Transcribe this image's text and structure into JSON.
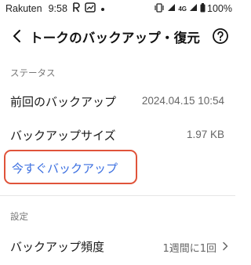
{
  "statusbar": {
    "carrier": "Rakuten",
    "time": "9:58",
    "network": "4G",
    "battery": "100%"
  },
  "appbar": {
    "title": "トークのバックアップ・復元"
  },
  "status_section": {
    "header": "ステータス",
    "last_backup_label": "前回のバックアップ",
    "last_backup_value": "2024.04.15 10:54",
    "backup_size_label": "バックアップサイズ",
    "backup_size_value": "1.97 KB",
    "backup_now_label": "今すぐバックアップ"
  },
  "settings_section": {
    "header": "設定",
    "frequency_label": "バックアップ頻度",
    "frequency_value": "1週間に1回"
  },
  "colors": {
    "link": "#3b6fe0",
    "highlight_outline": "#e0533a"
  }
}
